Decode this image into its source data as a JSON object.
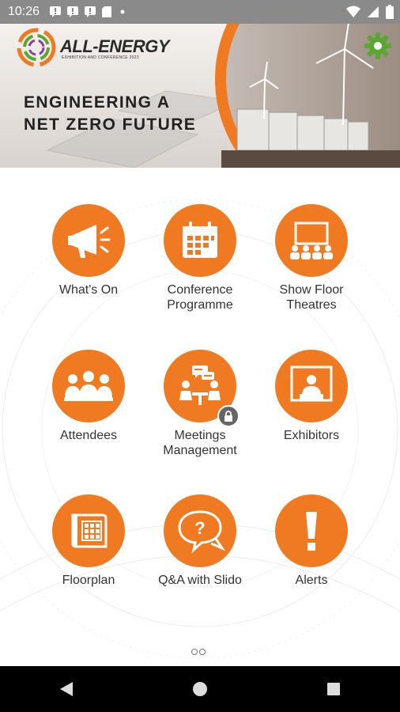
{
  "status_bar": {
    "time": "10:26",
    "icons": [
      "notification-icon",
      "notification-icon",
      "notification-icon",
      "sd-card-icon",
      "dot-icon"
    ],
    "right_icons": [
      "wifi-icon",
      "signal-icon",
      "battery-icon"
    ]
  },
  "header": {
    "brand": "ALL-ENERGY",
    "brand_sub": "EXHIBITION AND CONFERENCE 2023",
    "title_line1": "ENGINEERING A",
    "title_line2": "NET ZERO FUTURE",
    "settings_icon": "gear-icon"
  },
  "menu": {
    "items": [
      {
        "label": "What's On",
        "icon": "megaphone-icon"
      },
      {
        "label": "Conference Programme",
        "icon": "calendar-icon"
      },
      {
        "label": "Show Floor Theatres",
        "icon": "presentation-icon"
      },
      {
        "label": "Attendees",
        "icon": "people-icon"
      },
      {
        "label": "Meetings Management",
        "icon": "meeting-icon",
        "badge": "lock-icon"
      },
      {
        "label": "Exhibitors",
        "icon": "exhibitor-icon"
      },
      {
        "label": "Floorplan",
        "icon": "floorplan-icon"
      },
      {
        "label": "Q&A with Slido",
        "icon": "question-bubble-icon"
      },
      {
        "label": "Alerts",
        "icon": "alert-icon"
      }
    ]
  },
  "pager": {
    "pages": 2,
    "current": 1
  },
  "colors": {
    "accent": "#ef7a22",
    "settings": "#5aa832",
    "status_bar": "#8a8a8a",
    "nav_bar": "#000000"
  }
}
